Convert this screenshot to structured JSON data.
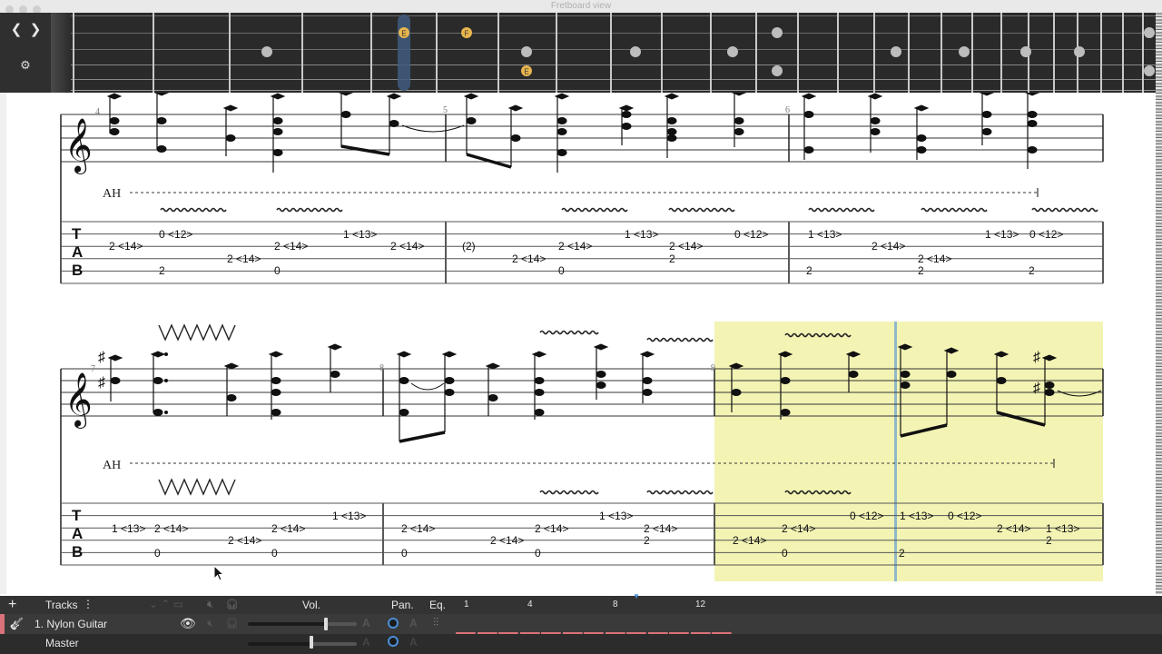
{
  "window": {
    "title": "Fretboard view"
  },
  "fretboard": {
    "prev_icon": "chevron-left-icon",
    "next_icon": "chevron-right-icon",
    "settings_icon": "gear-icon",
    "note_labels": [
      "E",
      "F",
      "E"
    ]
  },
  "score": {
    "systems": [
      {
        "measure_numbers": [
          "4",
          "5",
          "6"
        ],
        "technique_label": "AH",
        "tab_letters": [
          "T",
          "A",
          "B"
        ],
        "tab_rows": [
          [
            {
              "t": "0 <12>"
            },
            {
              "t": "1 <13>"
            },
            {
              "t": "1 <13>"
            },
            {
              "t": "0 <12>"
            },
            {
              "t": "1 <13>"
            },
            {
              "t": "1 <13>"
            },
            {
              "t": "0 <12>"
            }
          ],
          [
            {
              "t": "2 <14>"
            },
            {
              "t": "2 <14>"
            },
            {
              "t": "2 <14>"
            },
            {
              "t": "(2)"
            },
            {
              "t": "2 <14>"
            },
            {
              "t": "2 <14>"
            },
            {
              "t": "2 <14>"
            }
          ],
          [
            {
              "t": "2 <14>"
            },
            {
              "t": "2 <14>"
            },
            {
              "t": "2"
            },
            {
              "t": "2 <14>"
            }
          ],
          [
            {
              "t": "2"
            },
            {
              "t": "0"
            },
            {
              "t": "0"
            },
            {
              "t": "2"
            },
            {
              "t": "2"
            },
            {
              "t": "2"
            }
          ]
        ]
      },
      {
        "measure_numbers": [
          "7",
          "8",
          "9"
        ],
        "technique_label": "AH",
        "tab_letters": [
          "T",
          "A",
          "B"
        ],
        "tab_rows": [
          [
            {
              "t": "1 <13>"
            },
            {
              "t": "1 <13>"
            },
            {
              "t": "0 <12>"
            },
            {
              "t": "1 <13>"
            },
            {
              "t": "0 <12>"
            }
          ],
          [
            {
              "t": "1 <13>"
            },
            {
              "t": "2 <14>"
            },
            {
              "t": "2 <14>"
            },
            {
              "t": "2 <14>"
            },
            {
              "t": "2 <14>"
            },
            {
              "t": "2 <14>"
            },
            {
              "t": "2 <14>"
            },
            {
              "t": "2 <14>"
            },
            {
              "t": "1 <13>"
            }
          ],
          [
            {
              "t": "2 <14>"
            },
            {
              "t": "2 <14>"
            },
            {
              "t": "2"
            },
            {
              "t": "2 <14>"
            },
            {
              "t": "2"
            }
          ],
          [
            {
              "t": "0"
            },
            {
              "t": "0"
            },
            {
              "t": "0"
            },
            {
              "t": "0"
            },
            {
              "t": "0"
            },
            {
              "t": "2"
            }
          ]
        ]
      }
    ]
  },
  "tracks": {
    "add_icon": "plus-icon",
    "header": {
      "label": "Tracks",
      "menu_icon": "kebab-menu-icon",
      "vol": "Vol.",
      "pan": "Pan.",
      "eq": "Eq.",
      "bar_numbers": [
        "1",
        "4",
        "8",
        "12"
      ]
    },
    "track1": {
      "name": "1. Nylon Guitar",
      "icon": "guitar-icon",
      "visible_icon": "eye-icon",
      "auto_label": "A",
      "volume_level": 0.72,
      "bar_count": 13,
      "selected_bar": 9
    },
    "master": {
      "name": "Master",
      "volume_level": 0.58
    }
  },
  "colors": {
    "dark_panel": "#2b2b2b",
    "selection_highlight": "#f3f4b4",
    "track_bar": "#d9727a",
    "playback_cursor": "#8fb8c8",
    "accent_blue": "#4a8fd8"
  }
}
